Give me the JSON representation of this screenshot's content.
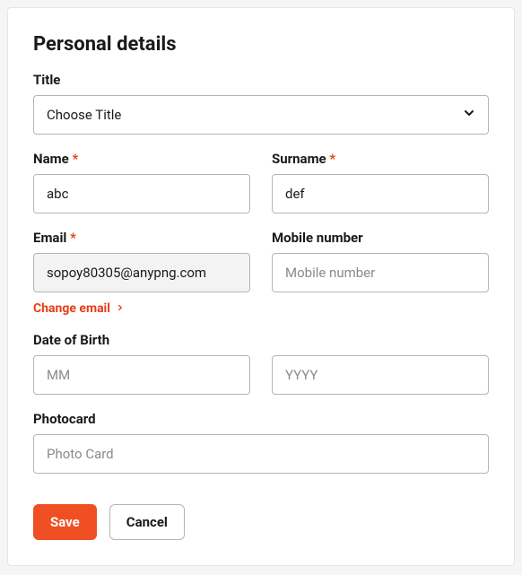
{
  "heading": "Personal details",
  "title": {
    "label": "Title",
    "placeholder": "Choose Title"
  },
  "name": {
    "label": "Name",
    "required": "*",
    "value": "abc"
  },
  "surname": {
    "label": "Surname",
    "required": "*",
    "value": "def"
  },
  "email": {
    "label": "Email",
    "required": "*",
    "value": "sopoy80305@anypng.com",
    "change_link": "Change email"
  },
  "mobile": {
    "label": "Mobile number",
    "placeholder": "Mobile number"
  },
  "dob": {
    "label": "Date of Birth",
    "mm_placeholder": "MM",
    "yyyy_placeholder": "YYYY"
  },
  "photocard": {
    "label": "Photocard",
    "placeholder": "Photo Card"
  },
  "buttons": {
    "save": "Save",
    "cancel": "Cancel"
  }
}
